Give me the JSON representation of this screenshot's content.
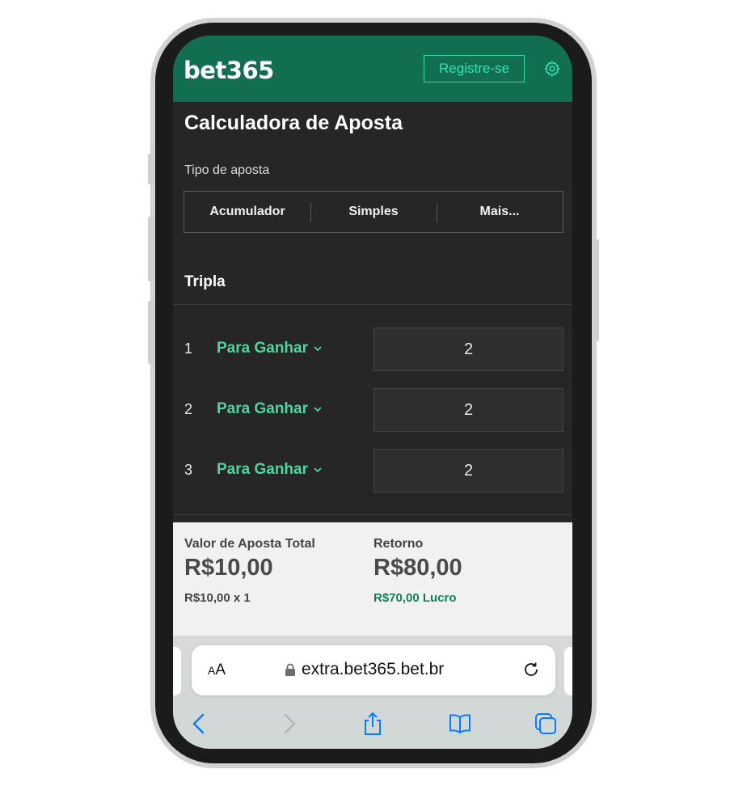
{
  "header": {
    "logo": "bet365",
    "register_label": "Registre-se"
  },
  "page": {
    "title": "Calculadora de Aposta",
    "bet_type_label": "Tipo de aposta",
    "bet_types": [
      "Acumulador",
      "Simples",
      "Mais..."
    ],
    "section_title": "Tripla"
  },
  "selections": [
    {
      "number": "1",
      "market": "Para Ganhar",
      "odds": "2"
    },
    {
      "number": "2",
      "market": "Para Ganhar",
      "odds": "2"
    },
    {
      "number": "3",
      "market": "Para Ganhar",
      "odds": "2"
    }
  ],
  "summary": {
    "stake_label": "Valor de Aposta Total",
    "stake_value": "R$10,00",
    "stake_detail": "R$10,00 x 1",
    "return_label": "Retorno",
    "return_value": "R$80,00",
    "profit": "R$70,00 Lucro"
  },
  "browser": {
    "aa_small": "A",
    "aa_large": "A",
    "url": "extra.bet365.bet.br"
  },
  "colors": {
    "header_green": "#126e51",
    "accent_mint": "#2ee6ae",
    "market_green": "#4cd6a0",
    "profit_green": "#148059",
    "ios_blue": "#0a7aff"
  },
  "icons": [
    "gear-icon",
    "chevron-down-icon",
    "lock-icon",
    "reload-icon",
    "back-icon",
    "forward-icon",
    "share-icon",
    "bookmarks-icon",
    "tabs-icon"
  ]
}
